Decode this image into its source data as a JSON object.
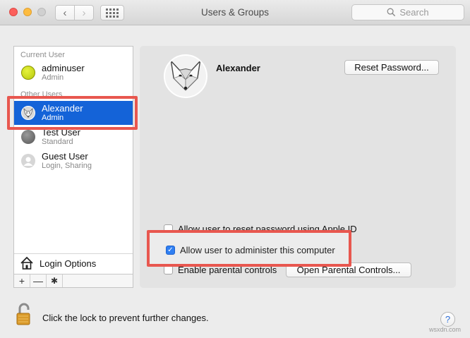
{
  "window": {
    "title": "Users & Groups",
    "search_placeholder": "Search",
    "nav_back": "‹",
    "nav_forward": "›"
  },
  "sidebar": {
    "current_user_label": "Current User",
    "other_users_label": "Other Users",
    "users": [
      {
        "name": "adminuser",
        "role": "Admin",
        "avatar": "tennis-ball-avatar"
      },
      {
        "name": "Alexander",
        "role": "Admin",
        "avatar": "fox-avatar",
        "selected": true
      },
      {
        "name": "Test User",
        "role": "Standard",
        "avatar": "gray-ball-avatar"
      },
      {
        "name": "Guest User",
        "role": "Login, Sharing",
        "avatar": "guest-silhouette-avatar"
      }
    ],
    "login_options": "Login Options",
    "tools": {
      "add": "+",
      "remove": "—",
      "gear": "✱"
    }
  },
  "panel": {
    "user_name": "Alexander",
    "reset_password": "Reset Password...",
    "options": [
      {
        "label": "Allow user to reset password using Apple ID",
        "checked": false
      },
      {
        "label": "Allow user to administer this computer",
        "checked": true
      },
      {
        "label": "Enable parental controls",
        "checked": false
      }
    ],
    "open_parental": "Open Parental Controls..."
  },
  "footer": {
    "lock_text": "Click the lock to prevent further changes.",
    "help": "?"
  },
  "watermark": "wsxdn.com",
  "colors": {
    "selection": "#1463d8",
    "highlight_box": "#e8574f",
    "checkbox_on": "#2f7ff2"
  }
}
